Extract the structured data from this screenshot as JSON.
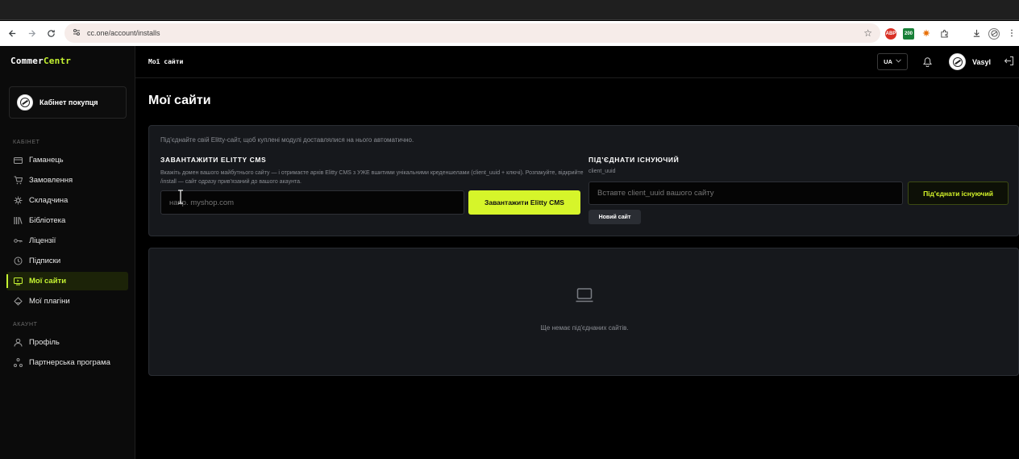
{
  "browser": {
    "url": "cc.one/account/installs"
  },
  "app": {
    "logo": {
      "part1": "Commer",
      "part2": "Centr"
    },
    "header_title": "Мої сайти",
    "lang": "UA",
    "user_name": "Vasyl"
  },
  "sidebar": {
    "cabinet_label": "Кабінет покупця",
    "section_cabinet": "КАБІНЕТ",
    "section_account": "АКАУНТ",
    "items": [
      {
        "label": "Гаманець",
        "icon": "wallet-icon"
      },
      {
        "label": "Замовлення",
        "icon": "cart-icon"
      },
      {
        "label": "Складчина",
        "icon": "sparkle-icon"
      },
      {
        "label": "Бібліотека",
        "icon": "library-icon"
      },
      {
        "label": "Ліцензії",
        "icon": "key-icon"
      },
      {
        "label": "Підписки",
        "icon": "clock-icon"
      },
      {
        "label": "Мої сайти",
        "icon": "monitor-icon",
        "active": true
      },
      {
        "label": "Мої плагіни",
        "icon": "puzzle-icon"
      }
    ],
    "account_items": [
      {
        "label": "Профіль",
        "icon": "user-icon"
      },
      {
        "label": "Партнерська програма",
        "icon": "network-icon"
      }
    ]
  },
  "main": {
    "page_title": "Мої сайти",
    "info": "Під'єднайте свій Elitty-сайт, щоб куплені модулі доставлялися на нього автоматично.",
    "download": {
      "title": "ЗАВАНТАЖИТИ ELITTY CMS",
      "description": "Вкажіть домен вашого майбутнього сайту — і отримаєте архів Elitty CMS з УЖЕ вшитими унікальними креденшелами (client_uuid + ключі). Розпакуйте, відкрийте /install — сайт одразу прив'язаний до вашого акаунта.",
      "placeholder": "напр. myshop.com",
      "button": "Завантажити Elitty CMS"
    },
    "connect": {
      "title": "ПІД'ЄДНАТИ ІСНУЮЧИЙ",
      "field_label": "client_uuid",
      "placeholder": "Вставте client_uuid вашого сайту",
      "button": "Під'єднати існуючий",
      "new_site_button": "Новий сайт"
    },
    "empty_text": "Ще немає під'єднаних сайтів."
  },
  "colors": {
    "accent": "#d6f52a",
    "panel_bg": "#16181c",
    "sidebar_active_bg": "#1c2308"
  }
}
